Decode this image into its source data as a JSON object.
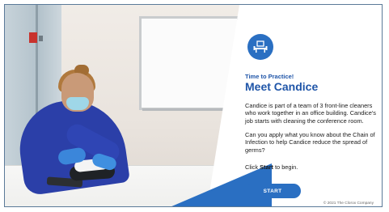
{
  "kicker": "Time to Practice!",
  "headline": "Meet Candice",
  "intro": "Candice is part of a team of 3 front-line cleaners who work together in an office building. Candice's job starts with cleaning the conference room.",
  "question": "Can you apply what you know about the Chain of Infection to help Candice reduce the spread of germs?",
  "instruction": {
    "prefix": "Click ",
    "emphasis": "Start",
    "suffix": " to begin."
  },
  "start_label": "START",
  "copyright": "© 2021 The Clorox Company",
  "icon": "meeting-room-icon",
  "colors": {
    "accent": "#2a6fc2",
    "headline": "#1f55a8"
  }
}
